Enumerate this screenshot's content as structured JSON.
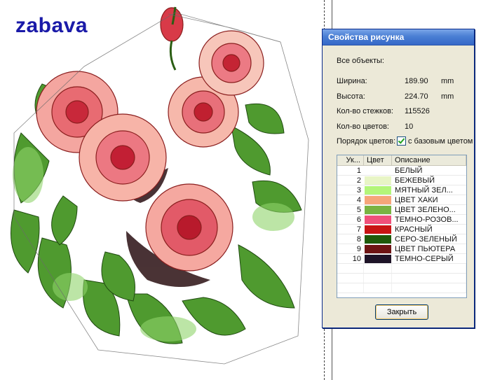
{
  "watermark": "zabava",
  "dialog": {
    "title": "Свойства рисунка",
    "all_objects_label": "Все объекты:",
    "width_label": "Ширина:",
    "width_value": "189.90",
    "width_unit": "mm",
    "height_label": "Высота:",
    "height_value": "224.70",
    "height_unit": "mm",
    "stitches_label": "Кол-во стежков:",
    "stitches_value": "115526",
    "colors_label": "Кол-во цветов:",
    "colors_value": "10",
    "order_label": "Порядок цветов:",
    "base_color_label": "с базовым цветом",
    "base_color_checked": true,
    "table": {
      "headers": [
        "Ук...",
        "Цвет",
        "Описание"
      ],
      "rows": [
        {
          "n": "1",
          "color": "#ffffff",
          "desc": "БЕЛЫЙ"
        },
        {
          "n": "2",
          "color": "#e8f5c6",
          "desc": "БЕЖЕВЫЙ"
        },
        {
          "n": "3",
          "color": "#b3f57a",
          "desc": "МЯТНЫЙ ЗЕЛ..."
        },
        {
          "n": "4",
          "color": "#f5a57a",
          "desc": "ЦВЕТ ХАКИ"
        },
        {
          "n": "5",
          "color": "#7ab342",
          "desc": "ЦВЕТ ЗЕЛЕНО..."
        },
        {
          "n": "6",
          "color": "#f0507a",
          "desc": "ТЕМНО-РОЗОВ..."
        },
        {
          "n": "7",
          "color": "#c81414",
          "desc": "КРАСНЫЙ"
        },
        {
          "n": "8",
          "color": "#1e5a0a",
          "desc": "СЕРО-ЗЕЛЕНЫЙ"
        },
        {
          "n": "9",
          "color": "#6e1414",
          "desc": "ЦВЕТ ПЬЮТЕРА"
        },
        {
          "n": "10",
          "color": "#1e1428",
          "desc": "ТЕМНО-СЕРЫЙ"
        }
      ]
    },
    "close_button": "Закрыть"
  },
  "colors": {
    "title_bar": "#3568c8",
    "watermark": "#1a1aa8",
    "dialog_bg": "#ece9d8"
  }
}
